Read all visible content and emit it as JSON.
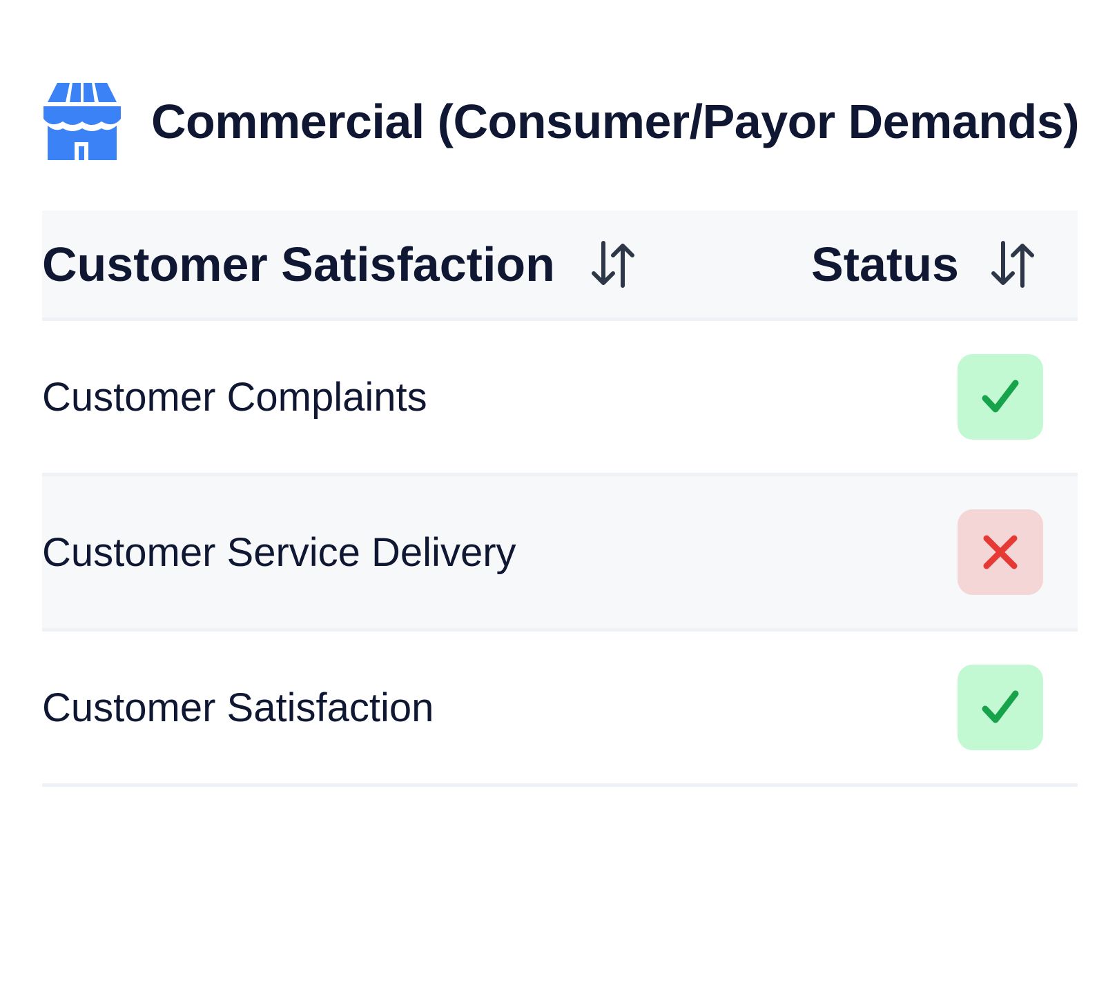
{
  "header": {
    "title": "Commercial (Consumer/Payor Demands)",
    "icon": "store-icon",
    "icon_color": "#3b82f6"
  },
  "table": {
    "columns": [
      {
        "label": "Customer Satisfaction",
        "sort_icon": "sort-arrows-icon"
      },
      {
        "label": "Status",
        "sort_icon": "sort-arrows-icon"
      }
    ],
    "rows": [
      {
        "label": "Customer Complaints",
        "status": "pass",
        "status_icon": "check-icon"
      },
      {
        "label": "Customer Service Delivery",
        "status": "fail",
        "status_icon": "x-icon"
      },
      {
        "label": "Customer Satisfaction",
        "status": "pass",
        "status_icon": "check-icon"
      }
    ]
  },
  "colors": {
    "text": "#0f1733",
    "header_bg": "#f7f8fa",
    "pass_bg": "#c2f8d2",
    "pass_icon": "#16a34a",
    "fail_bg": "#f5d6d6",
    "fail_icon": "#e53935"
  }
}
